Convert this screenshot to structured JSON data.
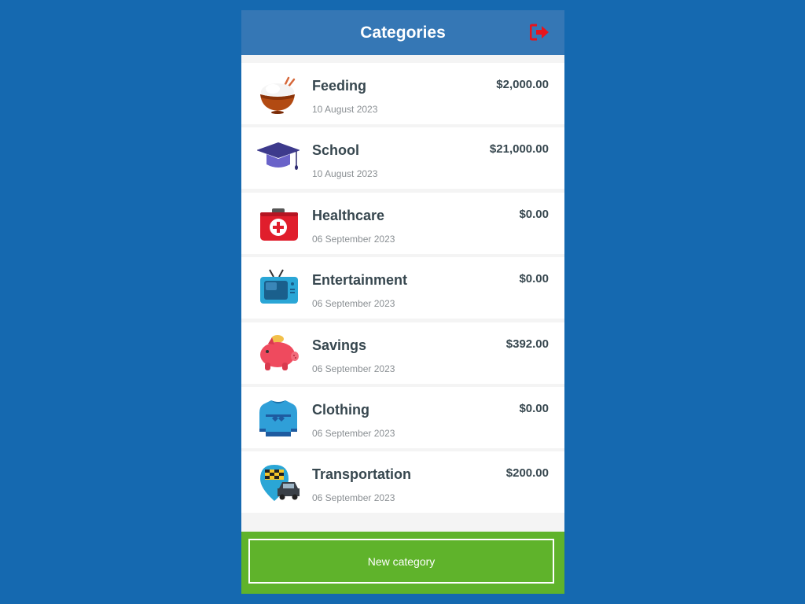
{
  "header": {
    "title": "Categories",
    "logout_icon": "logout-icon",
    "logout_color": "#e8141c"
  },
  "categories": [
    {
      "name": "Feeding",
      "date": "10 August 2023",
      "amount": "$2,000.00",
      "icon": "rice-bowl-icon"
    },
    {
      "name": "School",
      "date": "10 August 2023",
      "amount": "$21,000.00",
      "icon": "graduation-cap-icon"
    },
    {
      "name": "Healthcare",
      "date": "06 September 2023",
      "amount": "$0.00",
      "icon": "first-aid-kit-icon"
    },
    {
      "name": "Entertainment",
      "date": "06 September 2023",
      "amount": "$0.00",
      "icon": "television-icon"
    },
    {
      "name": "Savings",
      "date": "06 September 2023",
      "amount": "$392.00",
      "icon": "piggy-bank-icon"
    },
    {
      "name": "Clothing",
      "date": "06 September 2023",
      "amount": "$0.00",
      "icon": "sweater-icon"
    },
    {
      "name": "Transportation",
      "date": "06 September 2023",
      "amount": "$200.00",
      "icon": "taxi-icon"
    }
  ],
  "footer": {
    "new_category_label": "New category"
  },
  "colors": {
    "background": "#1569b0",
    "header": "#3577b5",
    "footer": "#5fb32b",
    "text": "#37474f"
  }
}
